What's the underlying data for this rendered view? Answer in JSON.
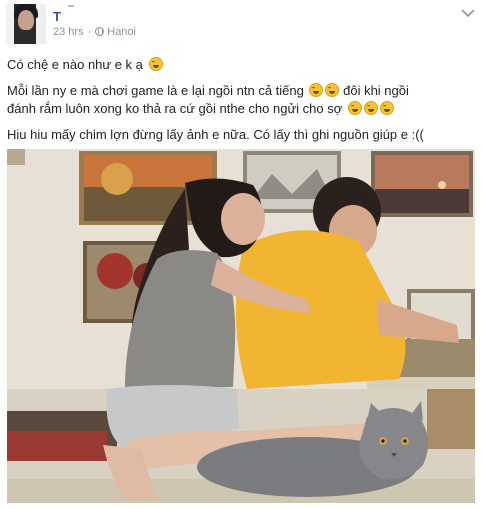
{
  "post": {
    "author_name": "T",
    "timestamp": "23 hrs",
    "separator": "·",
    "location": "Hanoi",
    "lines": [
      "Có chệ e nào như e k ạ",
      "Mỗi lần ny e mà chơi game là e lại ngồi ntn cả tiếng",
      "đôi khi ngồi",
      "đánh rắm luôn xong ko thả ra cứ gồi nthe cho ngửi cho sợ",
      "Hiu hiu mấy chim lợn đừng lấy ảnh e nữa. Có lấy thì ghi nguồn giúp e :(("
    ],
    "icons": {
      "options": "chevron-down-icon",
      "privacy": "globe-icon",
      "emoji": "grinning-squint-emoji"
    },
    "colors": {
      "author": "#365899",
      "meta": "#90949c",
      "text": "#1d2129",
      "emoji": "#f5c433"
    }
  }
}
